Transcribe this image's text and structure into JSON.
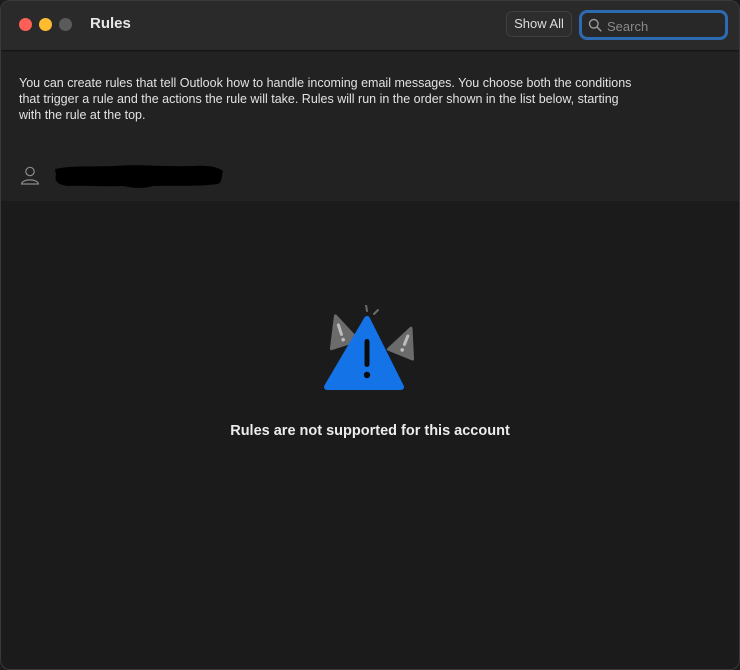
{
  "window": {
    "title": "Rules"
  },
  "toolbar": {
    "show_all_label": "Show All",
    "search_placeholder": "Search",
    "search_value": ""
  },
  "description": "You can create rules that tell Outlook how to handle incoming email messages. You choose both the conditions that trigger a rule and the actions the rule will take. Rules will run in the order shown in the list below, starting with the rule at the top.",
  "account": {
    "icon": "person-icon"
  },
  "empty_state": {
    "icon": "warning-triangle-icon",
    "message": "Rules are not supported for this account"
  },
  "colors": {
    "accent": "#2c6bb1",
    "warning_blue": "#1473e6",
    "close": "#fe5f57",
    "minimize": "#febc2e"
  }
}
